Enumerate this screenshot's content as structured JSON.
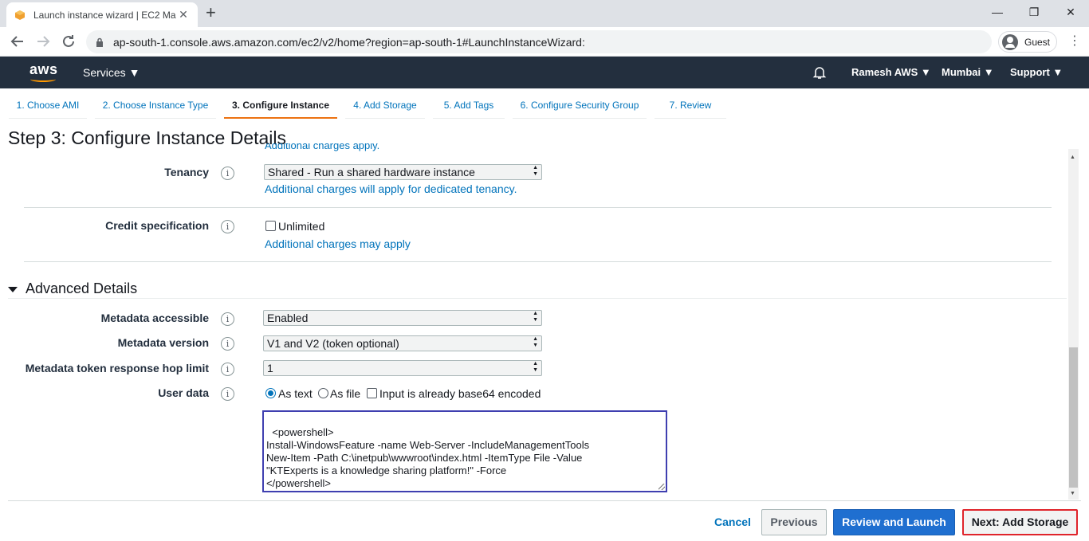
{
  "browser": {
    "tab_title": "Launch instance wizard | EC2 Ma",
    "tab_close": "✕",
    "new_tab": "+",
    "url": "ap-south-1.console.aws.amazon.com/ec2/v2/home?region=ap-south-1#LaunchInstanceWizard:",
    "profile": "Guest",
    "window_controls": {
      "minimize": "—",
      "restore": "❐",
      "close": "✕"
    }
  },
  "aws_nav": {
    "logo": "aws",
    "services": "Services ▼",
    "user": "Ramesh AWS ▼",
    "region": "Mumbai ▼",
    "support": "Support ▼"
  },
  "steps": [
    {
      "label": "1. Choose AMI"
    },
    {
      "label": "2. Choose Instance Type"
    },
    {
      "label": "3. Configure Instance"
    },
    {
      "label": "4. Add Storage"
    },
    {
      "label": "5. Add Tags"
    },
    {
      "label": "6. Configure Security Group"
    },
    {
      "label": "7. Review"
    }
  ],
  "page_title": "Step 3: Configure Instance Details",
  "cutoff_text": "Additional charges apply.",
  "tenancy": {
    "label": "Tenancy",
    "value": "Shared - Run a shared hardware instance",
    "note": "Additional charges will apply for dedicated tenancy."
  },
  "credit": {
    "label": "Credit specification",
    "option": "Unlimited",
    "note": "Additional charges may apply"
  },
  "advanced": {
    "title": "Advanced Details",
    "metadata_accessible": {
      "label": "Metadata accessible",
      "value": "Enabled"
    },
    "metadata_version": {
      "label": "Metadata version",
      "value": "V1 and V2 (token optional)"
    },
    "hop_limit": {
      "label": "Metadata token response hop limit",
      "value": "1"
    },
    "user_data": {
      "label": "User data",
      "as_text": "As text",
      "as_file": "As file",
      "base64": "Input is already base64 encoded",
      "content": "<powershell>\nInstall-WindowsFeature -name Web-Server -IncludeManagementTools\nNew-Item -Path C:\\inetpub\\wwwroot\\index.html -ItemType File -Value\n\"KTExperts is a knowledge sharing platform!\" -Force\n</powershell>"
    }
  },
  "info_glyph": "i",
  "footer": {
    "cancel": "Cancel",
    "previous": "Previous",
    "review": "Review and Launch",
    "next": "Next: Add Storage"
  }
}
